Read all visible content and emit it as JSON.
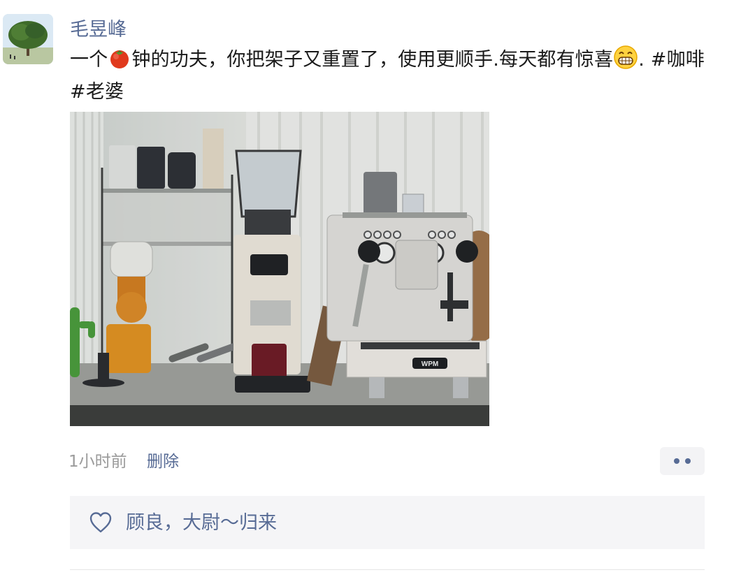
{
  "post": {
    "author": "毛昱峰",
    "text_before_tomato": "一个",
    "text_after_tomato": "钟的功夫，你把架子又重置了，使用更顺手.每天都有惊喜",
    "text_after_grin": ". #咖啡 #老婆",
    "tomato_icon": "tomato-emoji",
    "grin_icon": "grinning-face-emoji",
    "photo_icon": "coffee-corner-photo",
    "photo_brand_label": "WPM",
    "time": "1小时前",
    "delete_label": "删除",
    "more_icon": "more-dots-icon"
  },
  "likes": {
    "icon": "heart-outline-icon",
    "names": "顾良，大尉～归来"
  },
  "colors": {
    "link": "#576b95",
    "text": "#1a1a1a",
    "muted": "#9b9b9b",
    "panel": "#f5f5f7"
  }
}
